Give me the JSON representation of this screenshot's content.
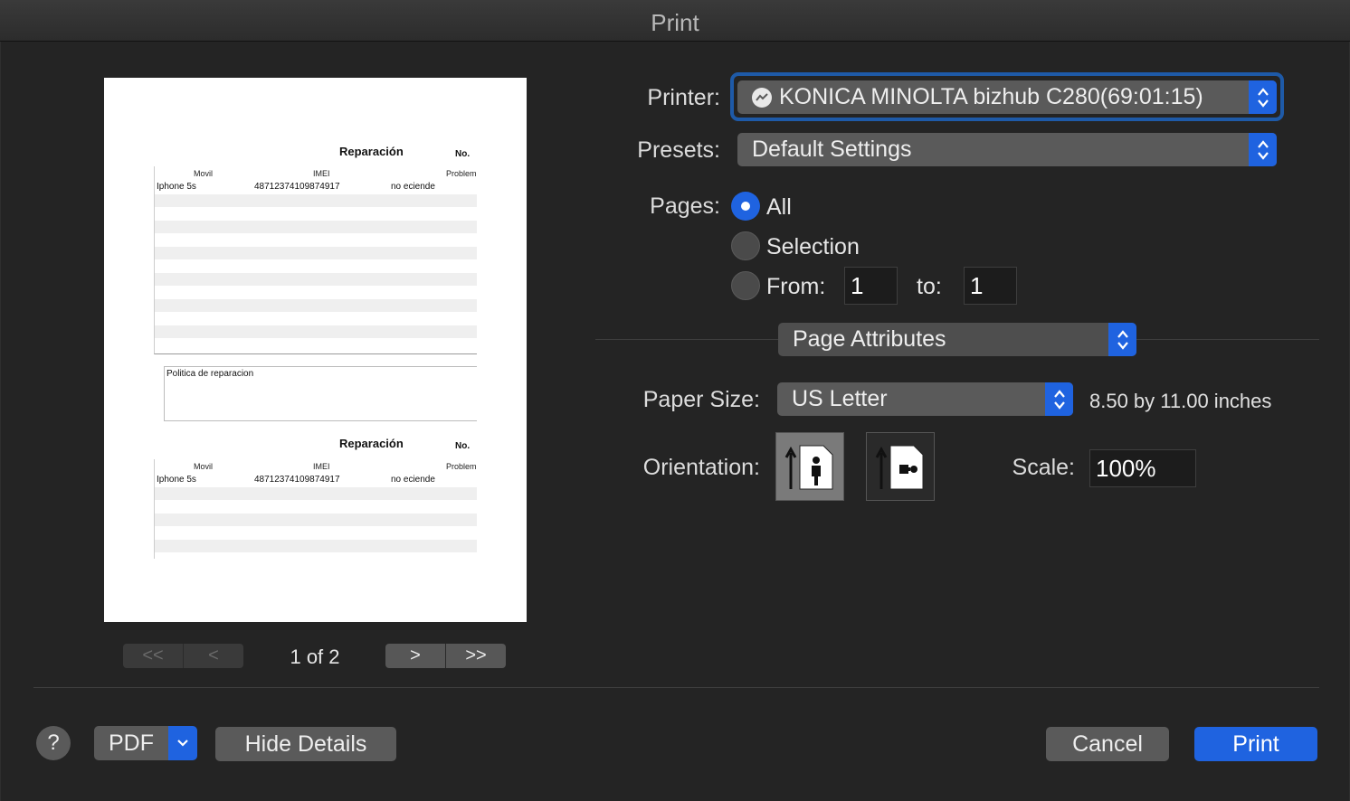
{
  "window": {
    "title": "Print"
  },
  "preview": {
    "sections": [
      {
        "title": "Reparación",
        "no_label": "No.",
        "headers": [
          "Movil",
          "IMEI",
          "Problem"
        ],
        "row": [
          "Iphone 5s",
          "48712374109874917",
          "no eciende"
        ]
      },
      {
        "title": "Reparación",
        "no_label": "No.",
        "headers": [
          "Movil",
          "IMEI",
          "Problem"
        ],
        "row": [
          "Iphone 5s",
          "48712374109874917",
          "no eciende"
        ]
      }
    ],
    "policy_label": "Politica de reparacion",
    "nav": {
      "first": "<<",
      "prev": "<",
      "next": ">",
      "last": ">>",
      "page_indicator": "1 of 2"
    }
  },
  "form": {
    "printer_label": "Printer:",
    "printer_value": "KONICA MINOLTA bizhub C280(69:01:15)",
    "presets_label": "Presets:",
    "presets_value": "Default Settings",
    "pages_label": "Pages:",
    "pages_options": {
      "all": "All",
      "selection": "Selection",
      "from": "From:",
      "to": "to:"
    },
    "pages_selected": "All",
    "from_value": "1",
    "to_value": "1",
    "section_popup": "Page Attributes",
    "paper_size_label": "Paper Size:",
    "paper_size_value": "US Letter",
    "paper_size_dimensions": "8.50 by 11.00 inches",
    "orientation_label": "Orientation:",
    "orientation_selected": "portrait",
    "scale_label": "Scale:",
    "scale_value": "100%"
  },
  "footer": {
    "help": "?",
    "pdf": "PDF",
    "hide_details": "Hide Details",
    "cancel": "Cancel",
    "print": "Print"
  },
  "colors": {
    "accent": "#1f63e0",
    "background": "#242424",
    "control": "#5a5a5a"
  }
}
